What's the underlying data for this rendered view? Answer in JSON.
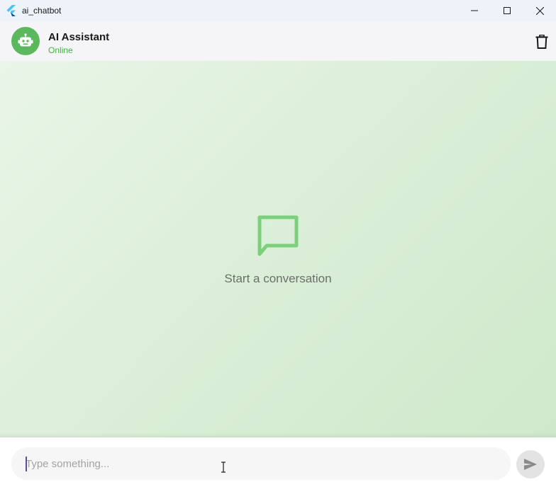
{
  "window": {
    "title": "ai_chatbot"
  },
  "header": {
    "name": "AI Assistant",
    "status": "Online",
    "avatar_icon": "robot-icon",
    "delete_icon": "trash-icon"
  },
  "chat": {
    "empty_icon": "chat-bubble-icon",
    "empty_text": "Start a conversation",
    "messages": []
  },
  "composer": {
    "placeholder": "Type something...",
    "value": "",
    "send_icon": "send-icon"
  },
  "colors": {
    "accent_green": "#5cb85c",
    "online_green": "#3ab53a",
    "empty_icon_green": "#7ccf7c"
  }
}
